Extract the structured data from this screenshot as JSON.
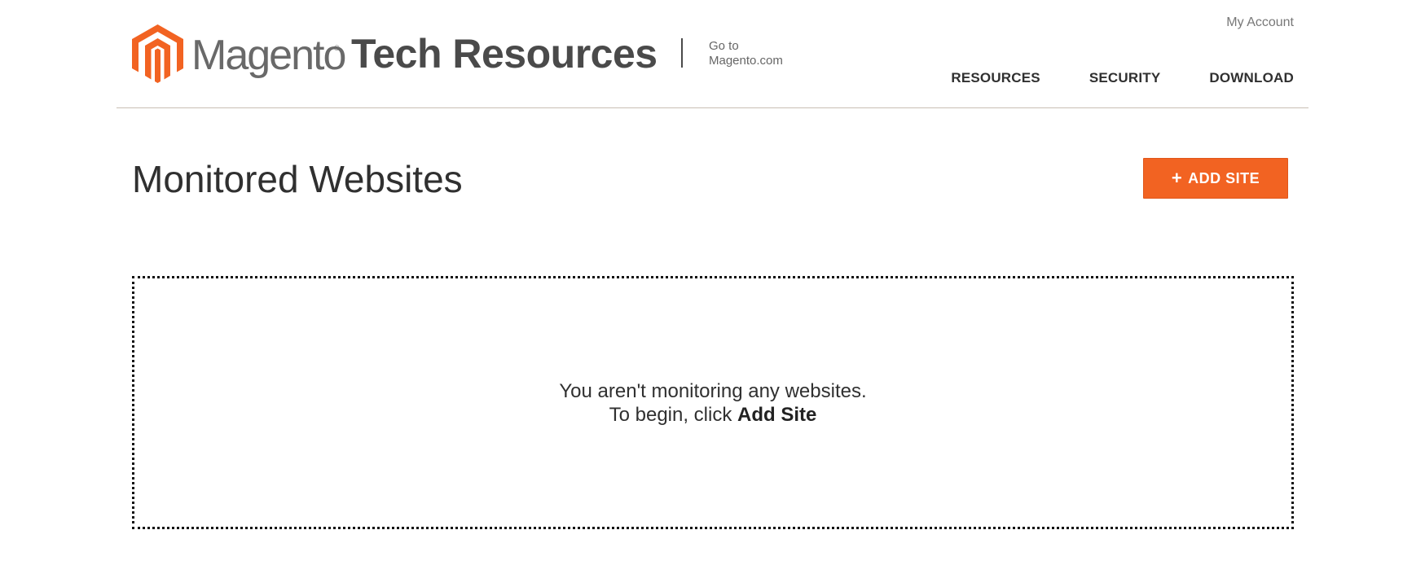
{
  "header": {
    "brand_word": "Magento",
    "brand_reg": "®",
    "brand_title": "Tech Resources",
    "goto_line1": "Go to",
    "goto_line2": "Magento.com",
    "my_account": "My Account",
    "nav": [
      "RESOURCES",
      "SECURITY",
      "DOWNLOAD"
    ]
  },
  "main": {
    "title": "Monitored Websites",
    "add_button_label": "ADD SITE",
    "empty_line1": "You aren't monitoring any websites.",
    "empty_line2_prefix": "To begin, click",
    "empty_line2_action": "Add Site"
  },
  "colors": {
    "brand_orange": "#f26322",
    "text_dark": "#303030",
    "divider": "#c9bfb4"
  },
  "icons": {
    "logo": "magento-logo-icon",
    "add": "plus-icon"
  }
}
